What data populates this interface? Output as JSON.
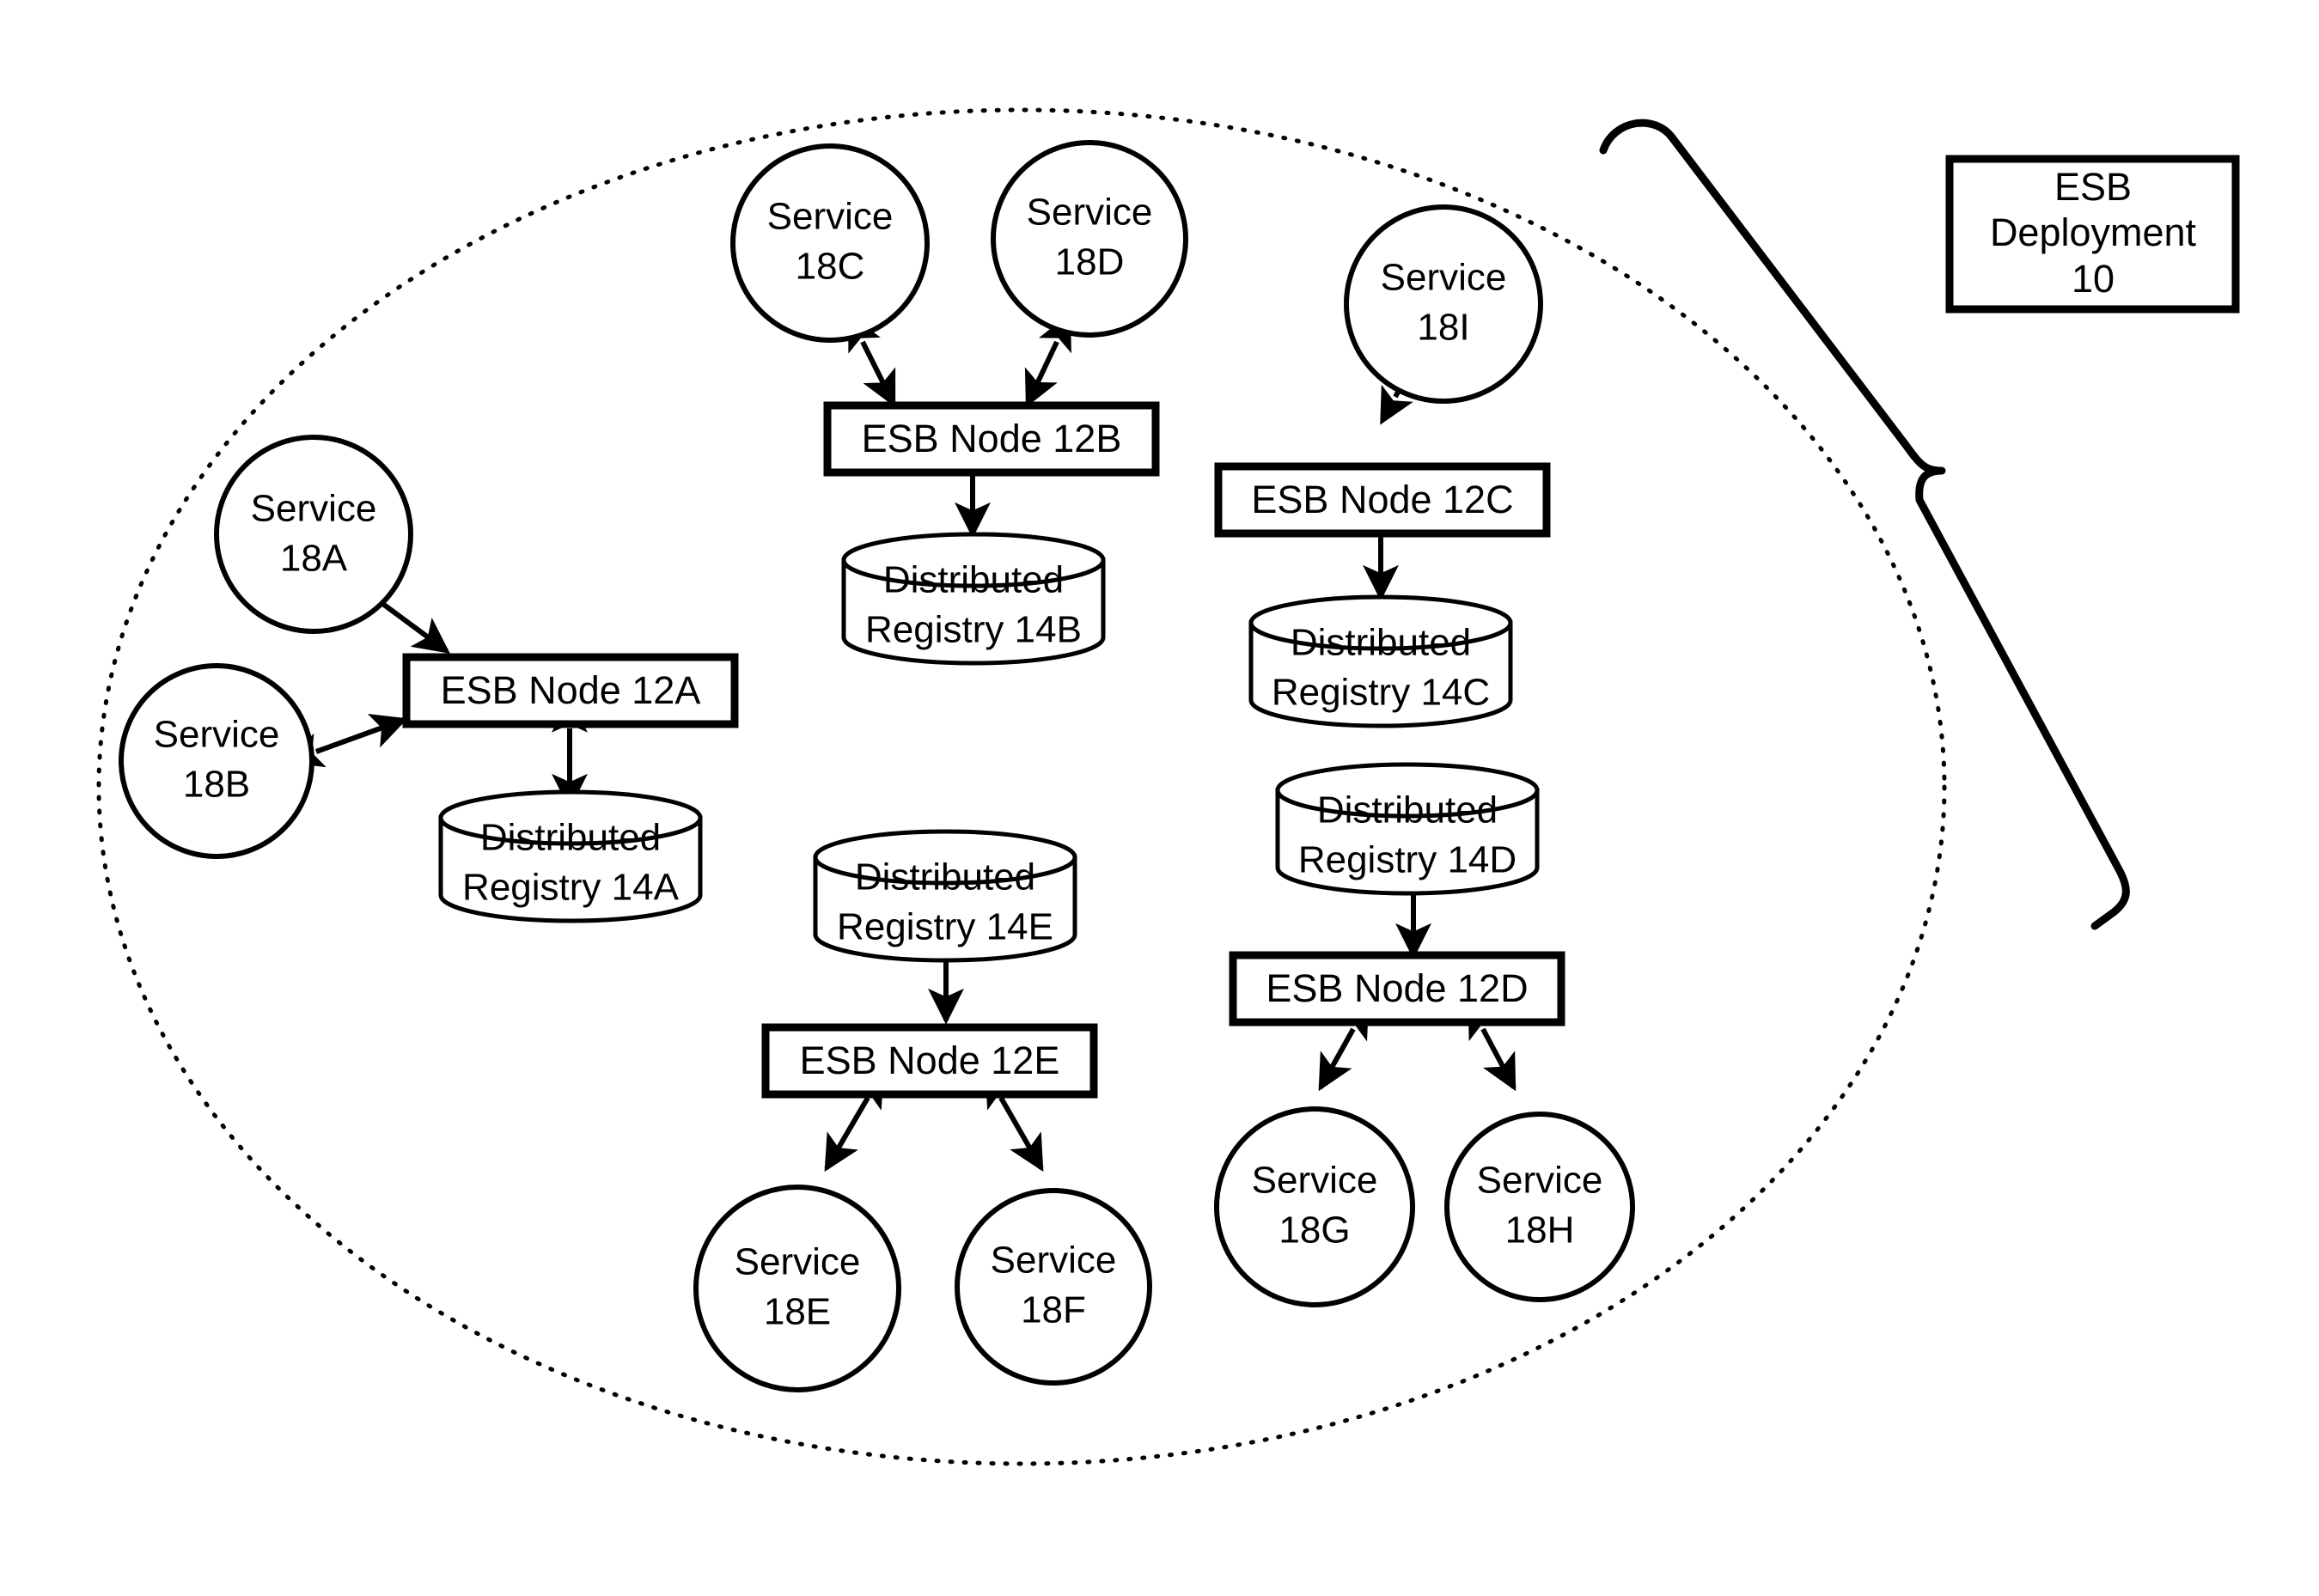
{
  "figure": {
    "type": "patent-diagram",
    "background_color": "#ffffff",
    "line_color": "#000000",
    "boundary": {
      "name": "esb-deployment-boundary",
      "style": "dotted-ellipse"
    }
  },
  "callout": {
    "label_line_1": "ESB",
    "label_line_2": "Deployment",
    "label_line_3": "10",
    "full_label": "ESB Deployment 10"
  },
  "nodes": [
    {
      "id": "12A",
      "label": "ESB Node 12A"
    },
    {
      "id": "12B",
      "label": "ESB Node 12B"
    },
    {
      "id": "12C",
      "label": "ESB Node 12C"
    },
    {
      "id": "12D",
      "label": "ESB Node 12D"
    },
    {
      "id": "12E",
      "label": "ESB Node 12E"
    }
  ],
  "registries": [
    {
      "id": "14A",
      "line1": "Distributed",
      "line2": "Registry 14A"
    },
    {
      "id": "14B",
      "line1": "Distributed",
      "line2": "Registry 14B"
    },
    {
      "id": "14C",
      "line1": "Distributed",
      "line2": "Registry 14C"
    },
    {
      "id": "14D",
      "line1": "Distributed",
      "line2": "Registry 14D"
    },
    {
      "id": "14E",
      "line1": "Distributed",
      "line2": "Registry 14E"
    }
  ],
  "services": [
    {
      "id": "18A",
      "line1": "Service",
      "line2": "18A"
    },
    {
      "id": "18B",
      "line1": "Service",
      "line2": "18B"
    },
    {
      "id": "18C",
      "line1": "Service",
      "line2": "18C"
    },
    {
      "id": "18D",
      "line1": "Service",
      "line2": "18D"
    },
    {
      "id": "18E",
      "line1": "Service",
      "line2": "18E"
    },
    {
      "id": "18F",
      "line1": "Service",
      "line2": "18F"
    },
    {
      "id": "18G",
      "line1": "Service",
      "line2": "18G"
    },
    {
      "id": "18H",
      "line1": "Service",
      "line2": "18H"
    },
    {
      "id": "18I",
      "line1": "Service",
      "line2": "18I"
    }
  ],
  "connections": [
    {
      "from": "18A",
      "to": "12A",
      "arrow": "both"
    },
    {
      "from": "18B",
      "to": "12A",
      "arrow": "both"
    },
    {
      "from": "12A",
      "to": "14A",
      "arrow": "both"
    },
    {
      "from": "18C",
      "to": "12B",
      "arrow": "both"
    },
    {
      "from": "18D",
      "to": "12B",
      "arrow": "both"
    },
    {
      "from": "12B",
      "to": "14B",
      "arrow": "both"
    },
    {
      "from": "18I",
      "to": "12C",
      "arrow": "both"
    },
    {
      "from": "12C",
      "to": "14C",
      "arrow": "both"
    },
    {
      "from": "14D",
      "to": "12D",
      "arrow": "both"
    },
    {
      "from": "12D",
      "to": "18G",
      "arrow": "both"
    },
    {
      "from": "12D",
      "to": "18H",
      "arrow": "both"
    },
    {
      "from": "14E",
      "to": "12E",
      "arrow": "both"
    },
    {
      "from": "12E",
      "to": "18E",
      "arrow": "both"
    },
    {
      "from": "12E",
      "to": "18F",
      "arrow": "both"
    }
  ]
}
